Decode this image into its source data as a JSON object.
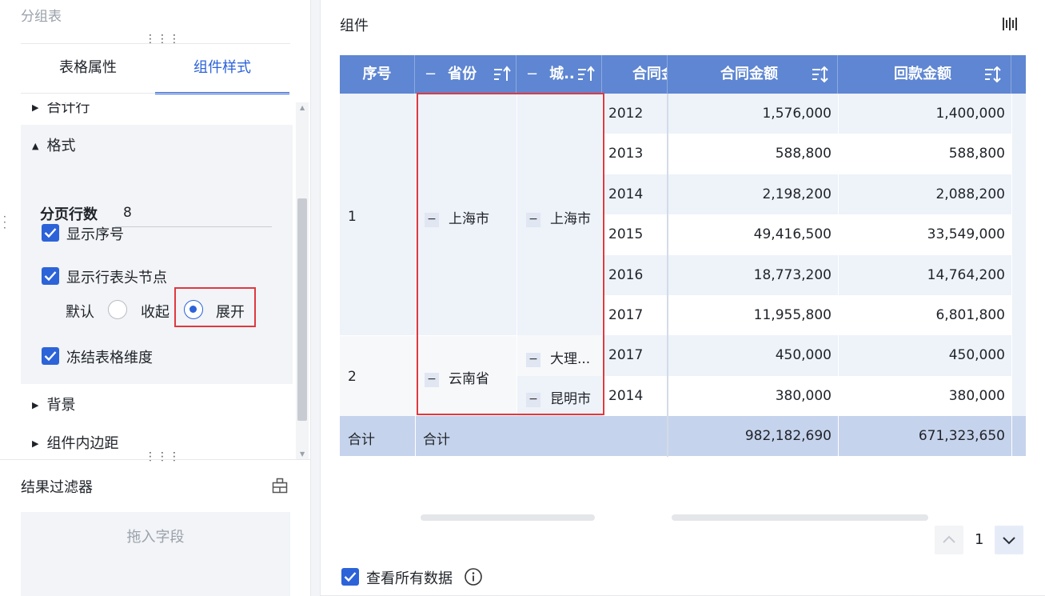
{
  "left_panel": {
    "title": "分组表",
    "tabs": [
      {
        "label": "表格属性",
        "active": false
      },
      {
        "label": "组件样式",
        "active": true
      }
    ],
    "sections": {
      "total_row": "合计行",
      "format": "格式",
      "background": "背景",
      "padding": "组件内边距"
    },
    "page_rows": {
      "label": "分页行数",
      "value": "8"
    },
    "checkboxes": {
      "show_index": {
        "label": "显示序号",
        "checked": true
      },
      "show_row_header_nodes": {
        "label": "显示行表头节点",
        "checked": true
      },
      "freeze_dimensions": {
        "label": "冻结表格维度",
        "checked": true
      }
    },
    "node_mode": {
      "label": "默认",
      "options": [
        {
          "label": "收起",
          "selected": false
        },
        {
          "label": "展开",
          "selected": true
        }
      ]
    },
    "filter": {
      "title": "结果过滤器",
      "drop_hint": "拖入字段"
    }
  },
  "right_panel": {
    "title": "组件",
    "table": {
      "headers": {
        "index": "序号",
        "province": "省份",
        "city": "城..",
        "contract": "合同金",
        "contract_amount": "合同金额",
        "payment_amount": "回款金额"
      },
      "header_minus": "−",
      "groups": [
        {
          "index": "1",
          "province": "上海市"
        },
        {
          "index": "2",
          "province": "云南省"
        }
      ],
      "cities": [
        "上海市",
        "大理...",
        "昆明市"
      ],
      "rows": [
        {
          "year": "2012",
          "contract_amount": "1,576,000",
          "payment_amount": "1,400,000"
        },
        {
          "year": "2013",
          "contract_amount": "588,800",
          "payment_amount": "588,800"
        },
        {
          "year": "2014",
          "contract_amount": "2,198,200",
          "payment_amount": "2,088,200"
        },
        {
          "year": "2015",
          "contract_amount": "49,416,500",
          "payment_amount": "33,549,000"
        },
        {
          "year": "2016",
          "contract_amount": "18,773,200",
          "payment_amount": "14,764,200"
        },
        {
          "year": "2017",
          "contract_amount": "11,955,800",
          "payment_amount": "6,801,800"
        },
        {
          "year": "2017",
          "contract_amount": "450,000",
          "payment_amount": "450,000"
        },
        {
          "year": "2014",
          "contract_amount": "380,000",
          "payment_amount": "380,000"
        }
      ],
      "total": {
        "index_label": "合计",
        "province_label": "合计",
        "contract_amount": "982,182,690",
        "payment_amount": "671,323,650"
      }
    },
    "pagination": {
      "current": "1"
    },
    "view_all": {
      "label": "查看所有数据",
      "checked": true
    }
  },
  "colors": {
    "accent": "#2d63d8",
    "header_bg": "#5e86d2",
    "highlight_border": "#e0393e",
    "total_bg": "#c6d3ec"
  },
  "icons": [
    "drag-handle-icon",
    "caret-right-icon",
    "caret-down-icon",
    "checkmark-icon",
    "sort-icon",
    "barcode-icon",
    "filter-settings-icon",
    "chevron-up-icon",
    "chevron-down-icon",
    "info-icon"
  ]
}
